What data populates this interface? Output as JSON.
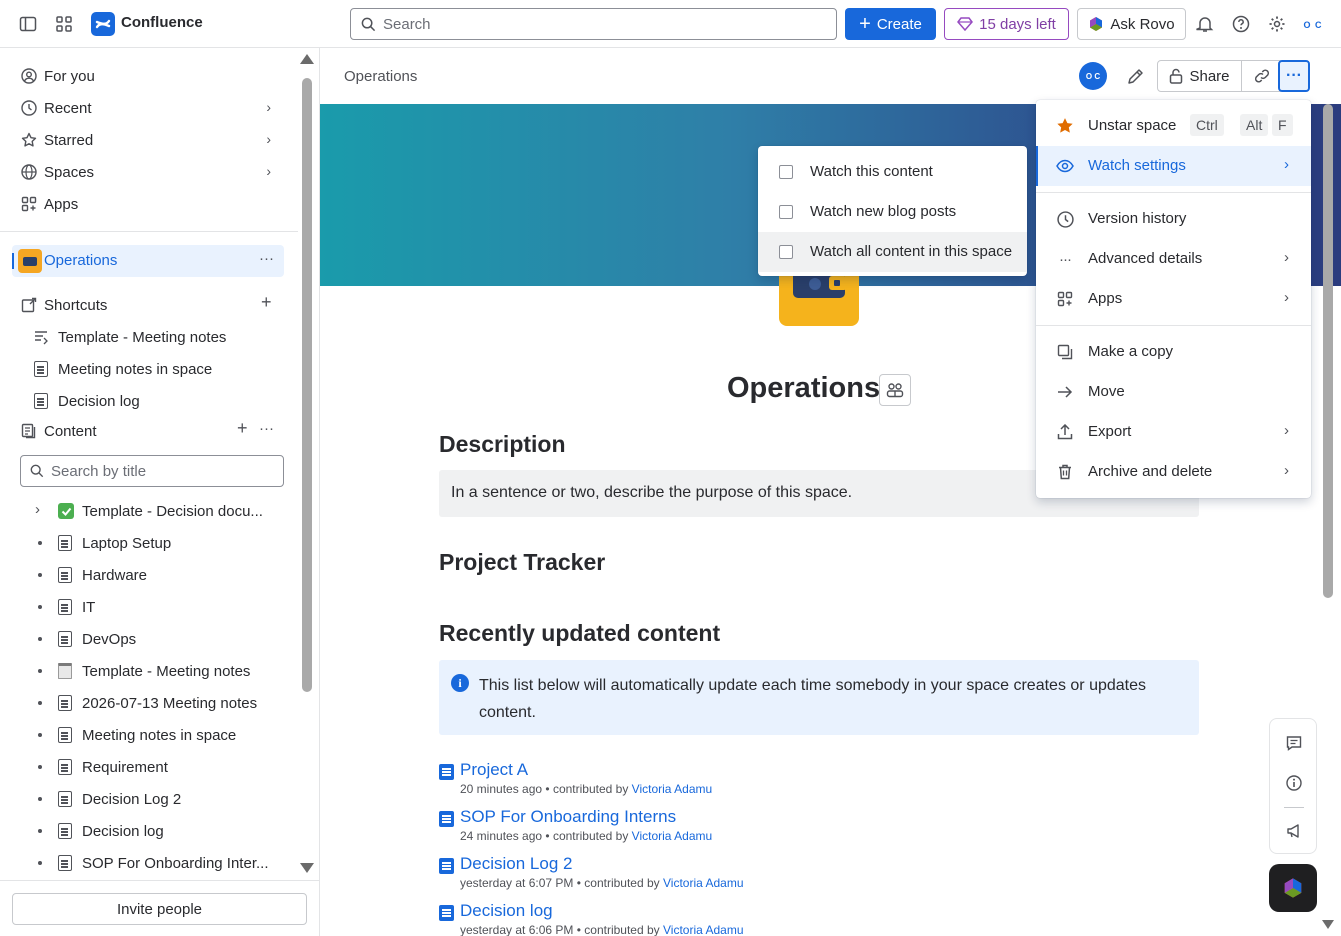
{
  "topbar": {
    "app_name": "Confluence",
    "search_placeholder": "Search",
    "create_label": "Create",
    "trial_label": "15 days left",
    "rovo_label": "Ask Rovo",
    "avatar_initials": "O C"
  },
  "sidebar": {
    "nav": [
      {
        "label": "For you",
        "icon": "person-circle-icon"
      },
      {
        "label": "Recent",
        "icon": "clock-icon"
      },
      {
        "label": "Starred",
        "icon": "star-icon"
      },
      {
        "label": "Spaces",
        "icon": "globe-icon"
      },
      {
        "label": "Apps",
        "icon": "apps-grid-icon"
      }
    ],
    "space_name": "Operations",
    "shortcuts_label": "Shortcuts",
    "shortcuts": [
      "Template - Meeting notes",
      "Meeting notes in space",
      "Decision log"
    ],
    "content_label": "Content",
    "search_placeholder": "Search by title",
    "content_items": [
      "Template - Decision docu...",
      "Laptop Setup",
      "Hardware",
      "IT",
      "DevOps",
      "Template - Meeting notes",
      "2026-07-13 Meeting notes",
      "Meeting notes in space",
      "Requirement",
      "Decision Log 2",
      "Decision log",
      "SOP For Onboarding Inter..."
    ],
    "invite_label": "Invite people"
  },
  "page": {
    "breadcrumb": "Operations",
    "share_label": "Share",
    "avatar_initials": "O C",
    "title": "Operations",
    "description_heading": "Description",
    "description_text": "In a sentence or two, describe the purpose of this space.",
    "tracker_heading": "Project Tracker",
    "recent_heading": "Recently updated content",
    "info_text": "This list below will automatically update each time somebody in your space creates or updates content.",
    "recent_items": [
      {
        "title": "Project A",
        "when": "20 minutes ago",
        "by_prefix": "• contributed by",
        "author": "Victoria Adamu"
      },
      {
        "title": "SOP For Onboarding Interns",
        "when": "24 minutes ago",
        "by_prefix": "• contributed by",
        "author": "Victoria Adamu"
      },
      {
        "title": "Decision Log 2",
        "when": "yesterday at 6:07 PM",
        "by_prefix": "• contributed by",
        "author": "Victoria Adamu"
      },
      {
        "title": "Decision log",
        "when": "yesterday at 6:06 PM",
        "by_prefix": "• contributed by",
        "author": "Victoria Adamu"
      }
    ]
  },
  "menu": {
    "unstar": "Unstar space",
    "keys": [
      "Ctrl",
      "Alt",
      "F"
    ],
    "watch_settings": "Watch settings",
    "version_history": "Version history",
    "advanced_details": "Advanced details",
    "apps": "Apps",
    "make_copy": "Make a copy",
    "move": "Move",
    "export": "Export",
    "archive_delete": "Archive and delete"
  },
  "watch_submenu": {
    "items": [
      "Watch this content",
      "Watch new blog posts",
      "Watch all content in this space"
    ]
  },
  "colors": {
    "accent": "#1868db",
    "star": "#e06c00",
    "trial": "#803fa5"
  }
}
